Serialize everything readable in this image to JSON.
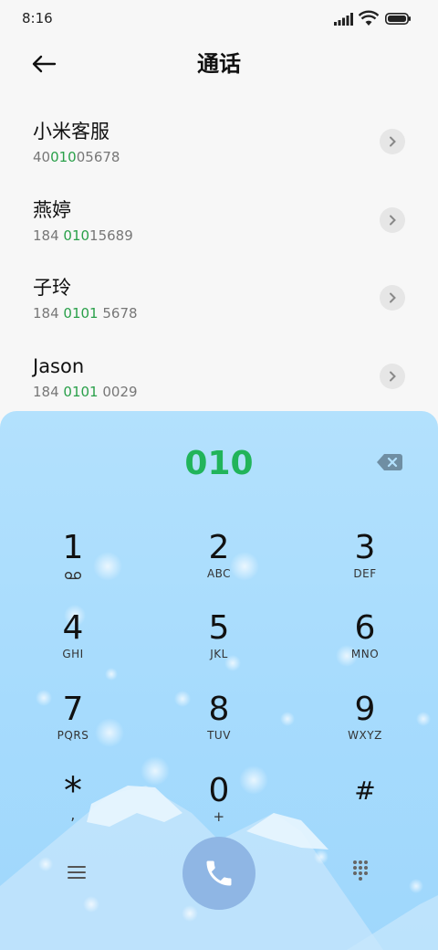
{
  "status_bar": {
    "time": "8:16",
    "icons": [
      "signal-icon",
      "wifi-icon",
      "battery-icon"
    ]
  },
  "header": {
    "back_icon": "arrow-left-icon",
    "title": "通话"
  },
  "contacts": [
    {
      "name": "小米客服",
      "number_parts": [
        "40",
        "010",
        "05678"
      ]
    },
    {
      "name": "燕婷",
      "number_parts": [
        "184 ",
        "010",
        "15689"
      ]
    },
    {
      "name": "子玲",
      "number_parts": [
        "184 ",
        "0101",
        " 5678"
      ]
    },
    {
      "name": "Jason",
      "number_parts": [
        "184 ",
        "0101",
        " 0029"
      ]
    }
  ],
  "dialpad": {
    "input": "010",
    "backspace_icon": "backspace-icon",
    "keys": [
      {
        "digit": "1",
        "letters": ""
      },
      {
        "digit": "2",
        "letters": "ABC"
      },
      {
        "digit": "3",
        "letters": "DEF"
      },
      {
        "digit": "4",
        "letters": "GHI"
      },
      {
        "digit": "5",
        "letters": "JKL"
      },
      {
        "digit": "6",
        "letters": "MNO"
      },
      {
        "digit": "7",
        "letters": "PQRS"
      },
      {
        "digit": "8",
        "letters": "TUV"
      },
      {
        "digit": "9",
        "letters": "WXYZ"
      },
      {
        "digit": "*",
        "letters": ","
      },
      {
        "digit": "0",
        "letters": "+"
      },
      {
        "digit": "#",
        "letters": ""
      }
    ],
    "key1_icon": "voicemail-icon",
    "menu_icon": "menu-icon",
    "call_icon": "phone-icon",
    "keypad_icon": "keypad-icon"
  },
  "colors": {
    "highlight": "#2aa04a",
    "dial_input": "#21b45a",
    "call_button": "#8fb6e4",
    "dialpad_bg": "#aadcfd"
  }
}
